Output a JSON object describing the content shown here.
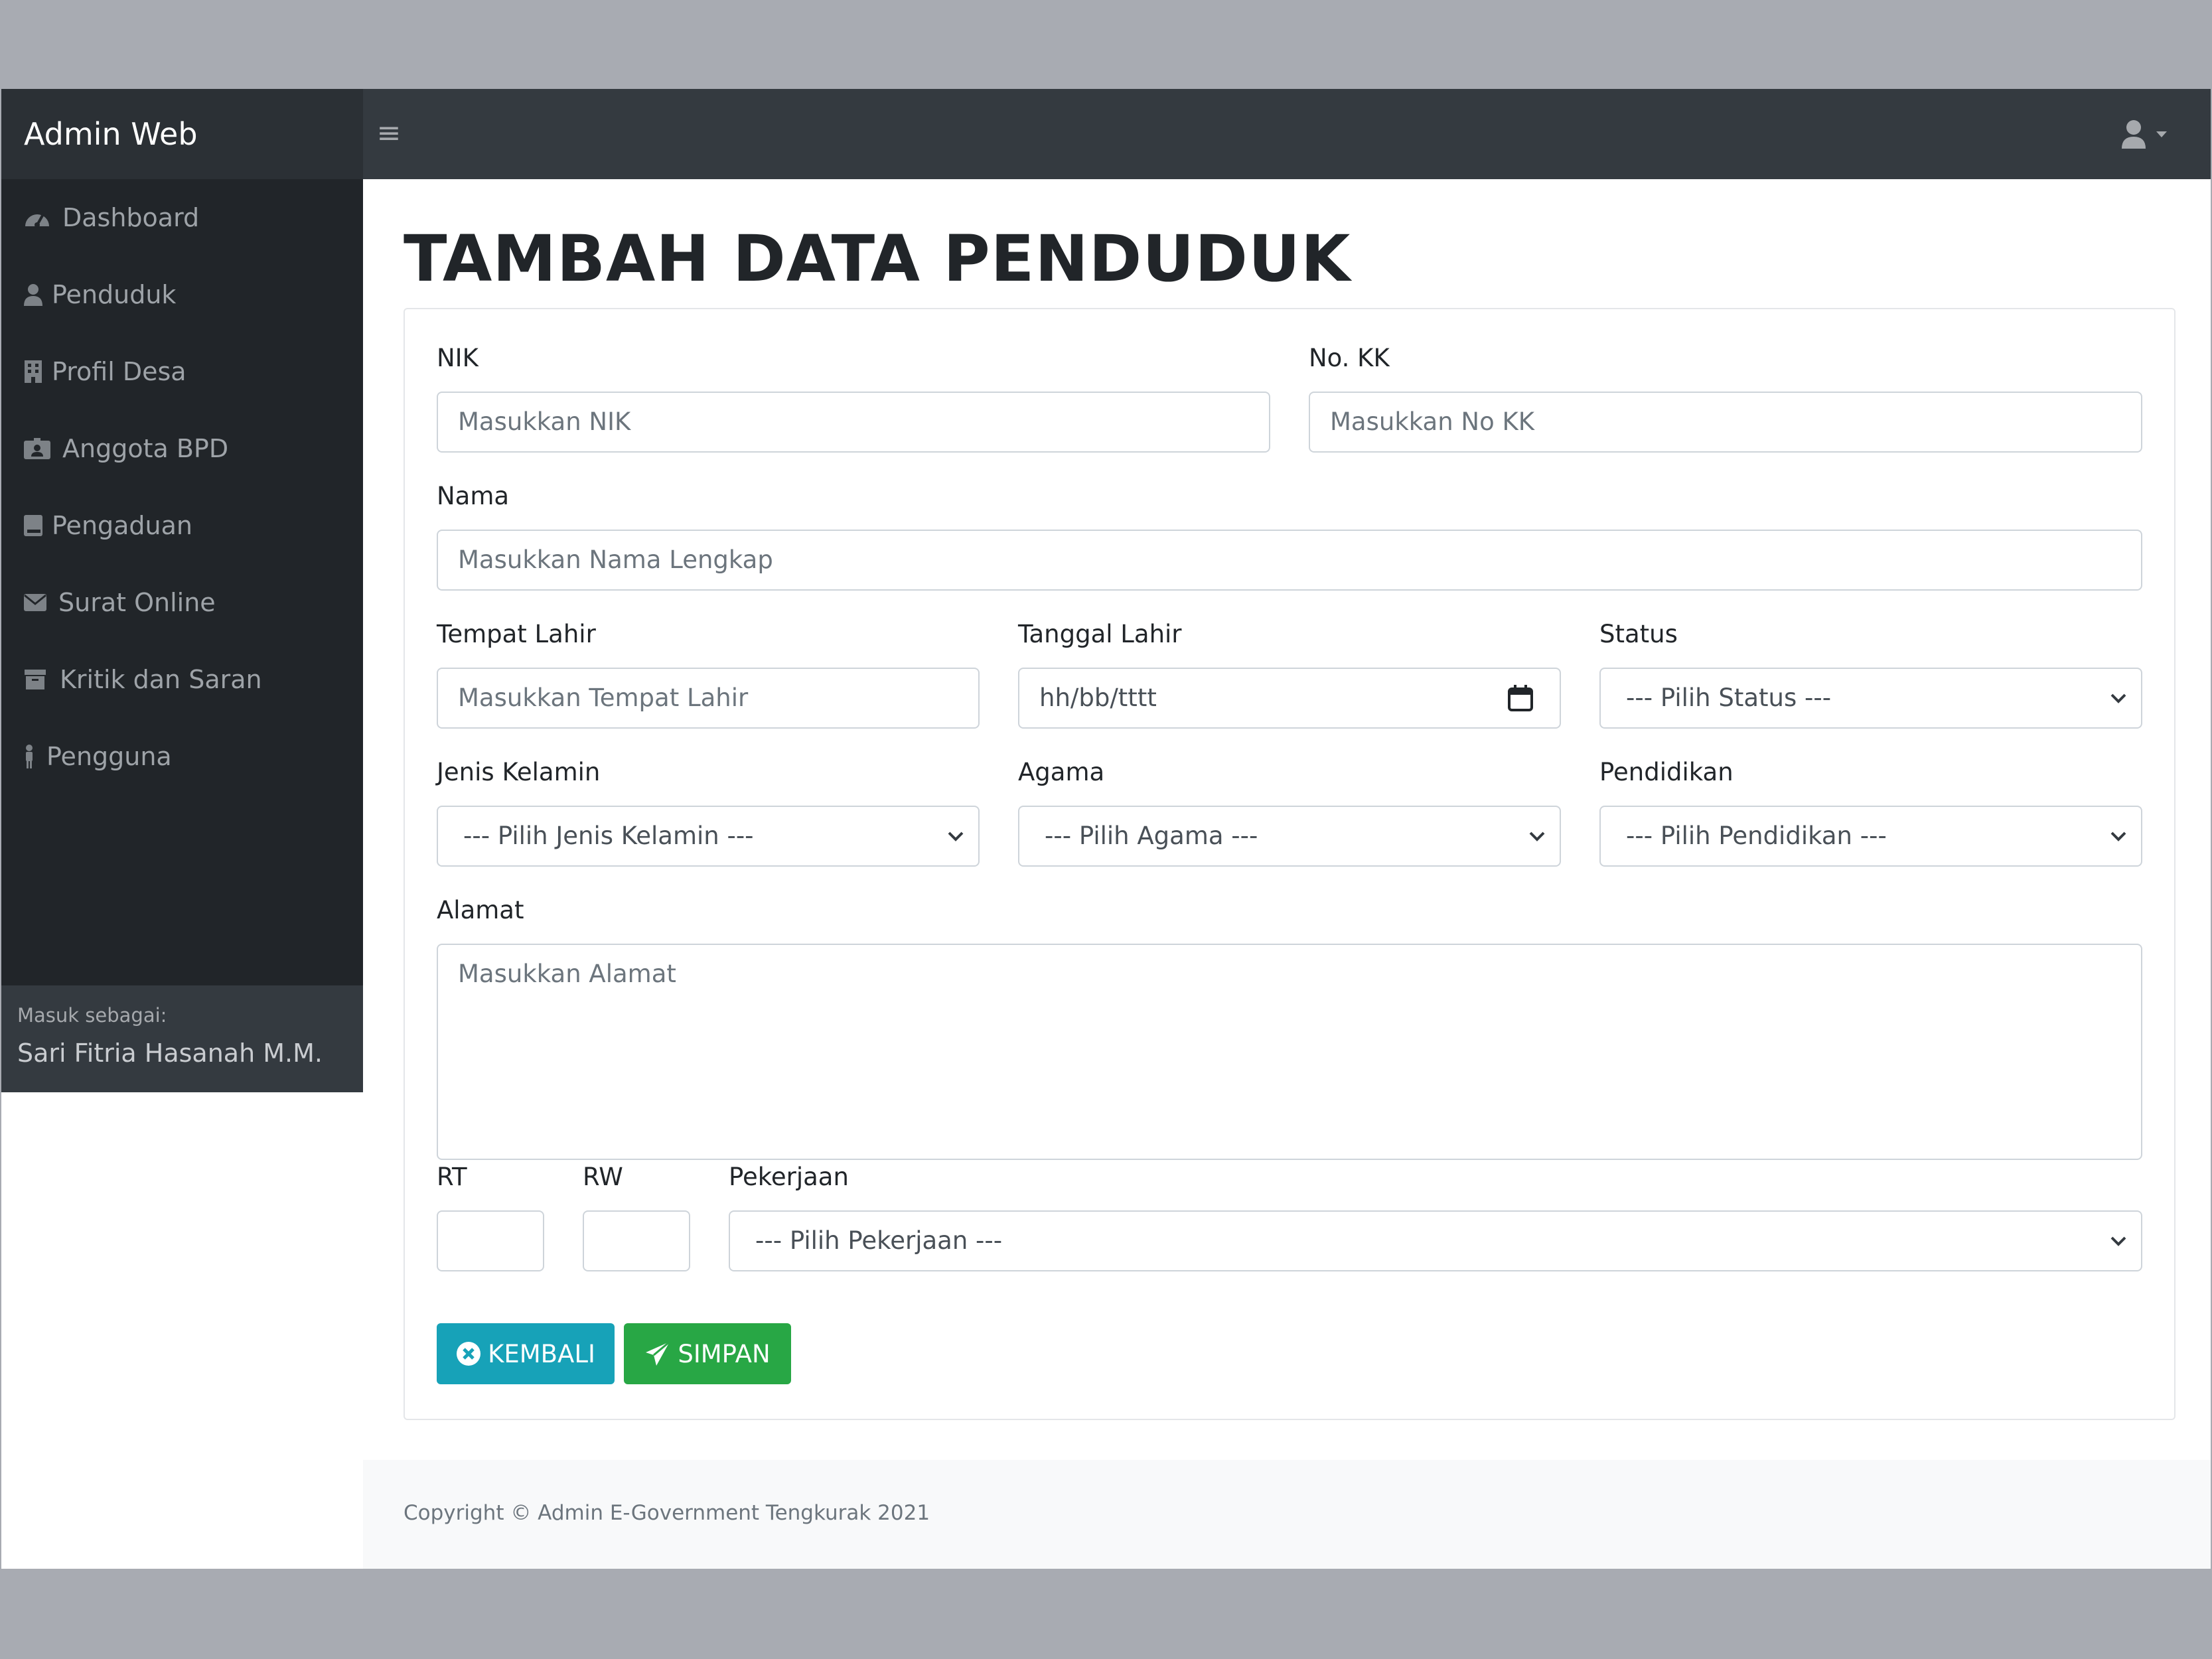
{
  "app": {
    "brand": "Admin Web"
  },
  "topbar": {
    "menu_icon": "hamburger-icon",
    "user_icon": "user-icon"
  },
  "sidebar": {
    "items": [
      {
        "label": "Dashboard",
        "icon": "tachometer-icon"
      },
      {
        "label": "Penduduk",
        "icon": "user-icon"
      },
      {
        "label": "Profil Desa",
        "icon": "building-icon"
      },
      {
        "label": "Anggota BPD",
        "icon": "id-badge-icon"
      },
      {
        "label": "Pengaduan",
        "icon": "book-icon"
      },
      {
        "label": "Surat Online",
        "icon": "envelope-icon"
      },
      {
        "label": "Kritik dan Saran",
        "icon": "archive-icon"
      },
      {
        "label": "Pengguna",
        "icon": "male-icon"
      }
    ],
    "footer": {
      "caption": "Masuk sebagai:",
      "user": "Sari Fitria Hasanah M.M."
    }
  },
  "page": {
    "title": "TAMBAH DATA PENDUDUK"
  },
  "form": {
    "nik": {
      "label": "NIK",
      "placeholder": "Masukkan NIK"
    },
    "no_kk": {
      "label": "No. KK",
      "placeholder": "Masukkan No KK"
    },
    "nama": {
      "label": "Nama",
      "placeholder": "Masukkan Nama Lengkap"
    },
    "tempat_lahir": {
      "label": "Tempat Lahir",
      "placeholder": "Masukkan Tempat Lahir"
    },
    "tanggal_lahir": {
      "label": "Tanggal Lahir",
      "placeholder": "hh/bb/tttt"
    },
    "status": {
      "label": "Status",
      "selected": "--- Pilih Status ---"
    },
    "jenis_kelamin": {
      "label": "Jenis Kelamin",
      "selected": "--- Pilih Jenis Kelamin ---"
    },
    "agama": {
      "label": "Agama",
      "selected": "--- Pilih Agama ---"
    },
    "pendidikan": {
      "label": "Pendidikan",
      "selected": "--- Pilih Pendidikan ---"
    },
    "alamat": {
      "label": "Alamat",
      "placeholder": "Masukkan Alamat"
    },
    "rt": {
      "label": "RT",
      "value": ""
    },
    "rw": {
      "label": "RW",
      "value": ""
    },
    "pekerjaan": {
      "label": "Pekerjaan",
      "selected": "--- Pilih Pekerjaan ---"
    }
  },
  "buttons": {
    "back": "KEMBALI",
    "save": "SIMPAN"
  },
  "colors": {
    "info": "#17a2b8",
    "success": "#28a745",
    "navbar": "#343a40",
    "sidebar": "#212529"
  },
  "footer": {
    "copyright": "Copyright © Admin E-Government Tengkurak 2021"
  }
}
